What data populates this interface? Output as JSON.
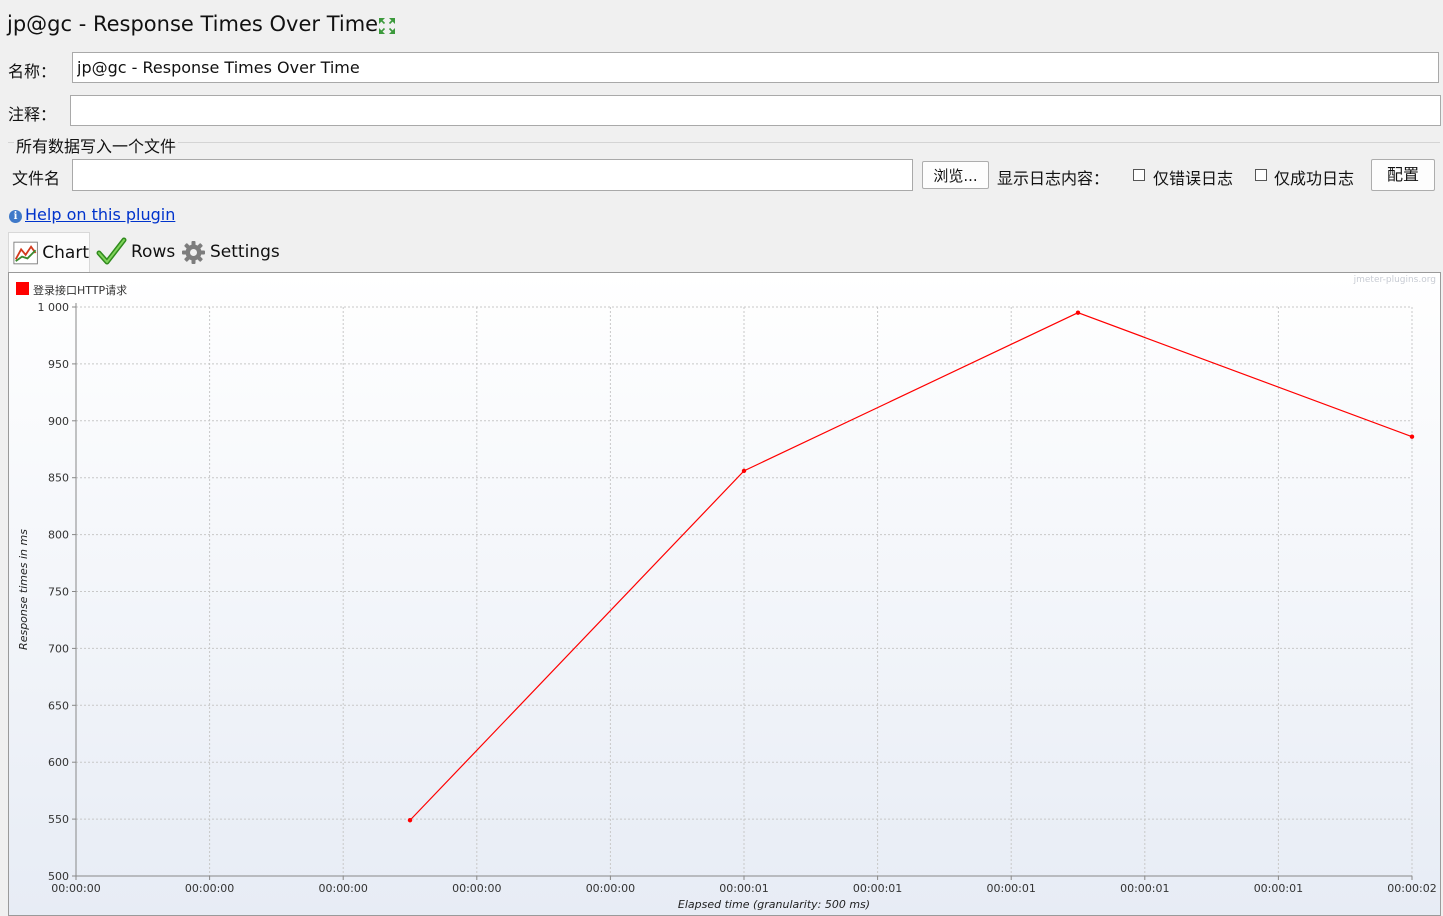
{
  "header": {
    "title": "jp@gc - Response Times Over Time",
    "expand_icon": "expand-arrows-icon"
  },
  "form": {
    "name_label": "名称：",
    "name_value": "jp@gc - Response Times Over Time",
    "comment_label": "注释：",
    "comment_value": "",
    "file_group_title": "所有数据写入一个文件",
    "filename_label": "文件名",
    "filename_value": "",
    "browse_button": "浏览...",
    "log_content_label": "显示日志内容：",
    "errors_only_label": "仅错误日志",
    "errors_only_checked": false,
    "success_only_label": "仅成功日志",
    "success_only_checked": false,
    "configure_button": "配置"
  },
  "help": {
    "link_text": "Help on this plugin",
    "icon": "info-icon"
  },
  "tabs": [
    {
      "label": "Chart",
      "icon": "chart-icon",
      "active": true
    },
    {
      "label": "Rows",
      "icon": "checkmark-icon",
      "active": false
    },
    {
      "label": "Settings",
      "icon": "gear-icon",
      "active": false
    }
  ],
  "chart": {
    "watermark": "jmeter-plugins.org"
  },
  "chart_data": {
    "type": "line",
    "title": "",
    "xlabel": "Elapsed time (granularity: 500 ms)",
    "ylabel": "Response times in ms",
    "x_unit": "seconds",
    "x": [
      0.5,
      1.0,
      1.5,
      2.0
    ],
    "series": [
      {
        "name": "登录接口HTTP请求",
        "color": "#ff0000",
        "values": [
          549,
          856,
          995,
          886
        ]
      }
    ],
    "ylim": [
      500,
      1000
    ],
    "xlim": [
      0,
      2
    ],
    "y_ticks": [
      500,
      550,
      600,
      650,
      700,
      750,
      800,
      850,
      900,
      950,
      1000
    ],
    "y_tick_labels": [
      "500",
      "550",
      "600",
      "650",
      "700",
      "750",
      "800",
      "850",
      "900",
      "950",
      "1 000"
    ],
    "x_tick_labels": [
      "00:00:00",
      "00:00:00",
      "00:00:00",
      "00:00:00",
      "00:00:00",
      "00:00:01",
      "00:00:01",
      "00:00:01",
      "00:00:01",
      "00:00:01",
      "00:00:02"
    ],
    "grid": true,
    "legend_position": "top-left"
  }
}
